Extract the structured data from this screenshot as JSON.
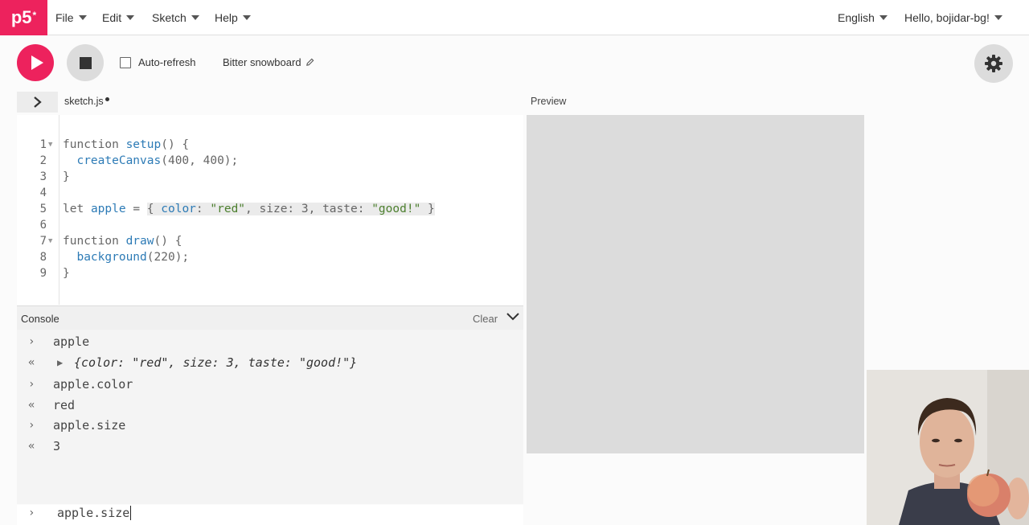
{
  "nav": {
    "logo": "p5",
    "logo_sup": "*",
    "menu": [
      {
        "label": "File"
      },
      {
        "label": "Edit"
      },
      {
        "label": "Sketch"
      },
      {
        "label": "Help"
      }
    ],
    "language": "English",
    "user_greeting": "Hello, bojidar-bg!"
  },
  "toolbar": {
    "auto_refresh_label": "Auto-refresh",
    "auto_refresh_checked": false,
    "sketch_name": "Bitter snowboard"
  },
  "editor": {
    "file_tab": "sketch.js",
    "preview_label": "Preview",
    "line_numbers": [
      "1",
      "2",
      "3",
      "4",
      "5",
      "6",
      "7",
      "8",
      "9"
    ]
  },
  "console": {
    "title": "Console",
    "clear_label": "Clear",
    "entries": [
      {
        "type": "input",
        "text": "apple"
      },
      {
        "type": "output-object",
        "text": "{color: \"red\", size: 3, taste: \"good!\"}"
      },
      {
        "type": "input",
        "text": "apple.color"
      },
      {
        "type": "output",
        "text": "red"
      },
      {
        "type": "input",
        "text": "apple.size"
      },
      {
        "type": "output",
        "text": "3"
      }
    ],
    "current_input": "apple.size"
  },
  "colors": {
    "brand": "#ed225d",
    "keyword_blue": "#2d7bb6",
    "string_green": "#4c7f2e"
  }
}
